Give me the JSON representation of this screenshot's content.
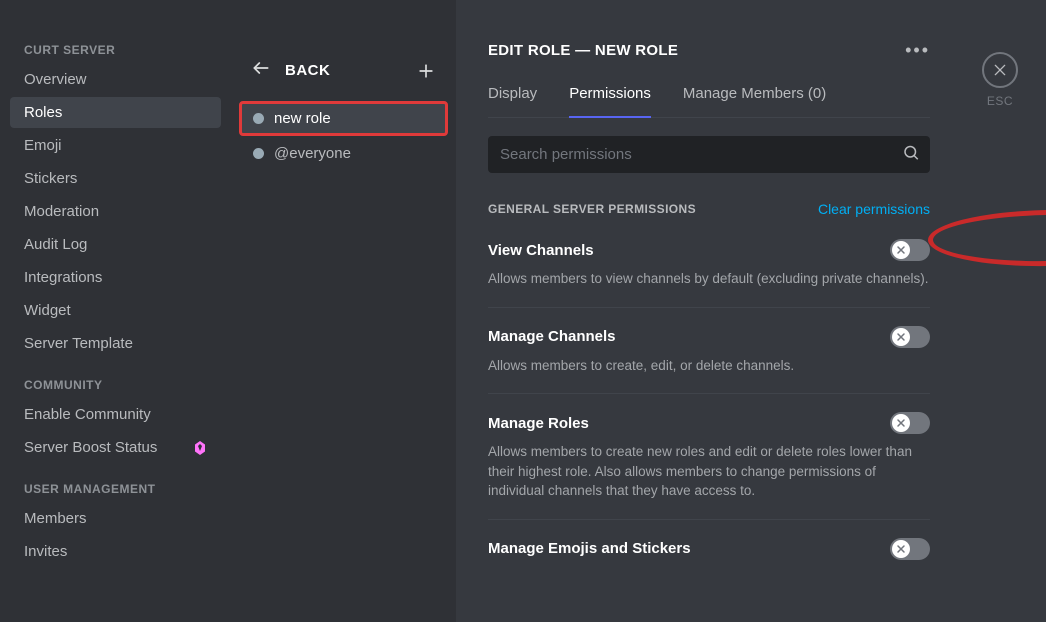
{
  "sidebar": {
    "section_server": "CURT SERVER",
    "section_community": "COMMUNITY",
    "section_user_mgmt": "USER MANAGEMENT",
    "items": {
      "overview": "Overview",
      "roles": "Roles",
      "emoji": "Emoji",
      "stickers": "Stickers",
      "moderation": "Moderation",
      "audit_log": "Audit Log",
      "integrations": "Integrations",
      "widget": "Widget",
      "server_template": "Server Template",
      "enable_community": "Enable Community",
      "boost_status": "Server Boost Status",
      "members": "Members",
      "invites": "Invites"
    }
  },
  "roles_panel": {
    "back": "BACK",
    "roles": [
      {
        "name": "new role"
      },
      {
        "name": "@everyone"
      }
    ]
  },
  "main": {
    "title": "EDIT ROLE — NEW ROLE",
    "tabs": {
      "display": "Display",
      "permissions": "Permissions",
      "members": "Manage Members (0)"
    },
    "search_placeholder": "Search permissions",
    "section_label": "GENERAL SERVER PERMISSIONS",
    "clear": "Clear permissions",
    "perms": [
      {
        "name": "View Channels",
        "desc": "Allows members to view channels by default (excluding private channels)."
      },
      {
        "name": "Manage Channels",
        "desc": "Allows members to create, edit, or delete channels."
      },
      {
        "name": "Manage Roles",
        "desc": "Allows members to create new roles and edit or delete roles lower than their highest role. Also allows members to change permissions of individual channels that they have access to."
      },
      {
        "name": "Manage Emojis and Stickers",
        "desc": ""
      }
    ]
  },
  "close": {
    "esc": "ESC"
  }
}
